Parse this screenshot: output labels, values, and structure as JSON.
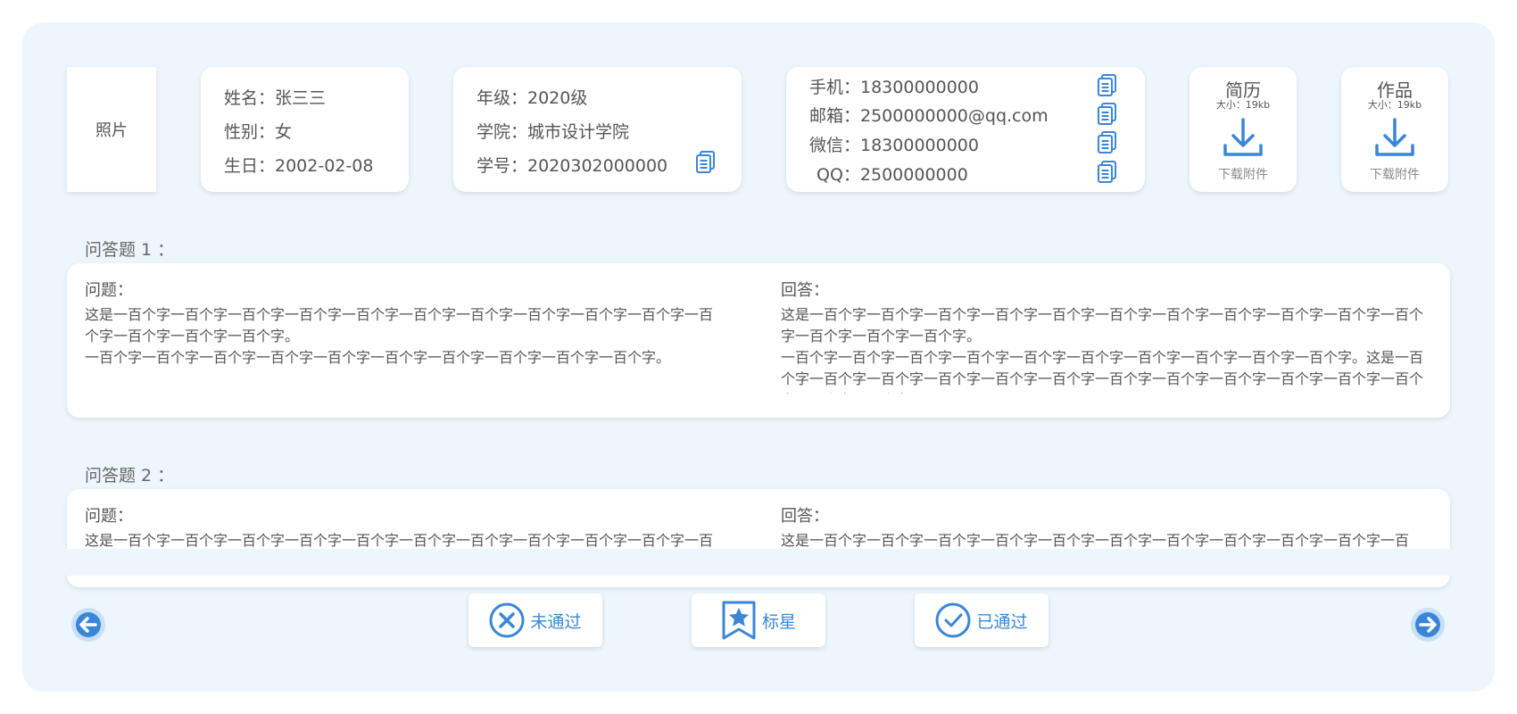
{
  "profile": {
    "photo_label": "照片",
    "name": "姓名：张三三",
    "gender": "性别：女",
    "birthday": "生日：2002-02-08"
  },
  "school": {
    "grade": "年级：2020级",
    "college": "学院：城市设计学院",
    "student_id": "学号：2020302000000"
  },
  "contact": {
    "phone": "手机：18300000000",
    "email": "邮箱：2500000000@qq.com",
    "wechat": "微信：18300000000",
    "qq": "QQ：2500000000"
  },
  "files": [
    {
      "title": "简历",
      "size": "大小：19kb",
      "link": "下载附件"
    },
    {
      "title": "作品",
      "size": "大小：19kb",
      "link": "下载附件"
    }
  ],
  "qa": [
    {
      "title": "问答题 1 ：",
      "question_label": "问题：",
      "question_text": "这是一百个字一百个字一百个字一百个字一百个字一百个字一百个字一百个字一百个字一百个字一百个字一百个字一百个字一百个字。\n一百个字一百个字一百个字一百个字一百个字一百个字一百个字一百个字一百个字一百个字。",
      "answer_label": "回答：",
      "answer_text": "这是一百个字一百个字一百个字一百个字一百个字一百个字一百个字一百个字一百个字一百个字一百个字一百个字一百个字一百个字。\n一百个字一百个字一百个字一百个字一百个字一百个字一百个字一百个字一百个字一百个字。这是一百个字一百个字一百个字一百个字一百个字一百个字一百个字一百个字一百个字一百个字一百个字一百个字一百个字一百个字。"
    },
    {
      "title": "问答题 2 ：",
      "question_label": "问题：",
      "question_text": "这是一百个字一百个字一百个字一百个字一百个字一百个字一百个字一百个字一百个字一百个字一百",
      "answer_label": "回答：",
      "answer_text": "这是一百个字一百个字一百个字一百个字一百个字一百个字一百个字一百个字一百个字一百个字一百"
    }
  ],
  "actions": {
    "reject": "未通过",
    "star": "标星",
    "pass": "已通过"
  },
  "colors": {
    "accent": "#3a86d6",
    "panel_bg": "#eef6fd"
  }
}
